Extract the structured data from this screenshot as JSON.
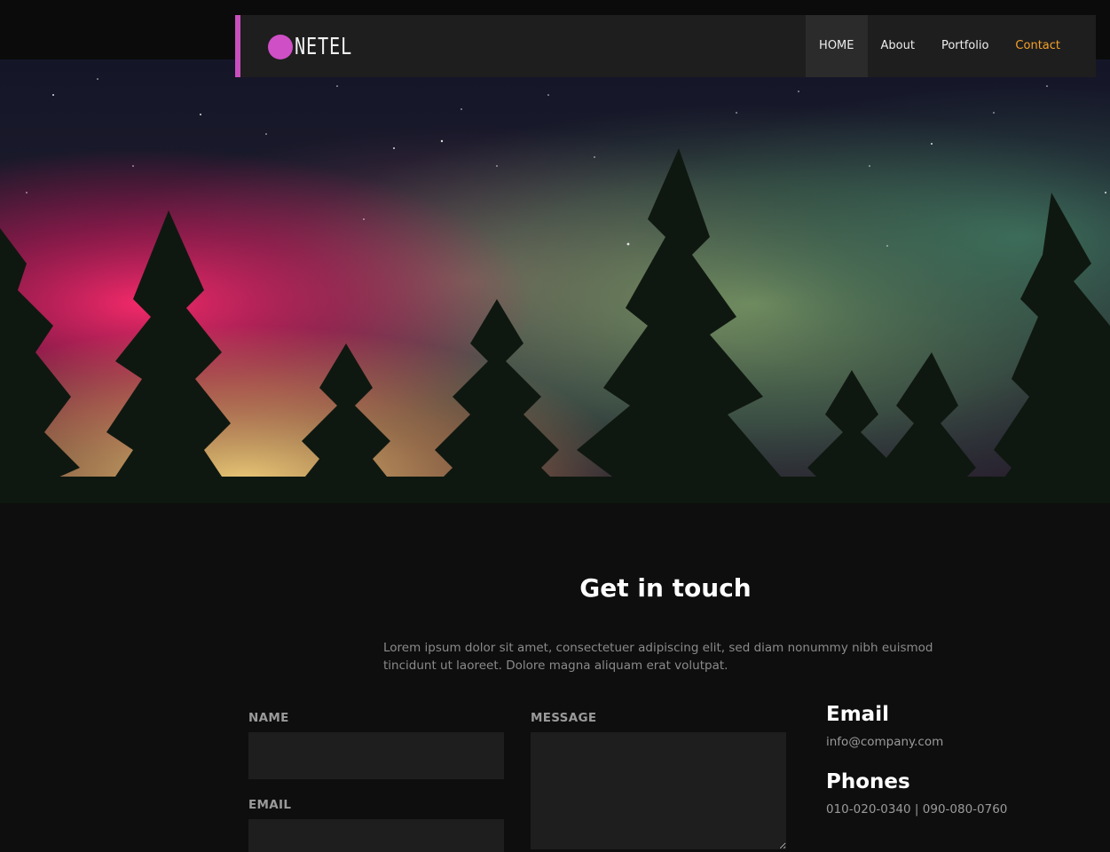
{
  "brand": {
    "logo_text": "NETEL",
    "accent_color": "#cf4fc6"
  },
  "nav": {
    "items": [
      {
        "label": "HOME"
      },
      {
        "label": "About"
      },
      {
        "label": "Portfolio"
      },
      {
        "label": "Contact"
      }
    ],
    "highlight_color": "#f5a12b"
  },
  "hero": {
    "image": "aurora-over-pine-forest-image"
  },
  "contact": {
    "title": "Get in touch",
    "intro": "Lorem ipsum dolor sit amet, consectetuer adipiscing elit, sed diam nonummy nibh euismod tincidunt ut laoreet. Dolore magna aliquam erat volutpat.",
    "form": {
      "name_label": "NAME",
      "email_label": "EMAIL",
      "message_label": "MESSAGE"
    },
    "info": {
      "email_title": "Email",
      "email_value": "info@company.com",
      "phones_title": "Phones",
      "phones_value": "010-020-0340 | 090-080-0760"
    }
  }
}
